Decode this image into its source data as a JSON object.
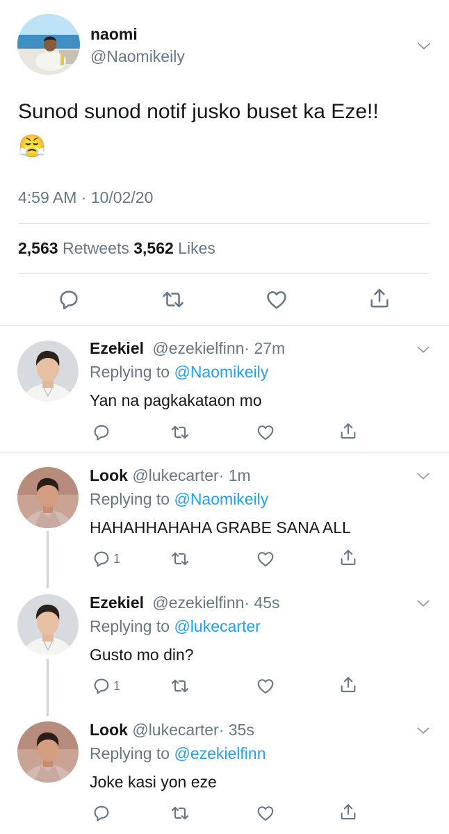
{
  "main_tweet": {
    "display_name": "naomi",
    "handle": "@Naomikeily",
    "text": "Sunod sunod notif jusko buset ka Eze!!",
    "emoji": "😤",
    "timestamp": "4:59 AM · 10/02/20",
    "retweets_count": "2,563",
    "retweets_label": "Retweets",
    "likes_count": "3,562",
    "likes_label": "Likes"
  },
  "replies": [
    {
      "display_name": "Ezekiel",
      "handle": "@ezekielfinn",
      "time": "· 27m",
      "replying_prefix": "Replying to",
      "replying_to": "@Naomikeily",
      "text": "Yan na pagkakataon mo",
      "reply_count": ""
    },
    {
      "display_name": "Look",
      "handle": "@lukecarter",
      "time": "· 1m",
      "replying_prefix": "Replying to",
      "replying_to": "@Naomikeily",
      "text": "HAHAHHAHAHA GRABE SANA ALL",
      "reply_count": "1"
    },
    {
      "display_name": "Ezekiel",
      "handle": "@ezekielfinn",
      "time": "· 45s",
      "replying_prefix": "Replying to",
      "replying_to": "@lukecarter",
      "text": "Gusto mo din?",
      "reply_count": "1"
    },
    {
      "display_name": "Look",
      "handle": "@lukecarter",
      "time": "· 35s",
      "replying_prefix": "Replying to",
      "replying_to": "@ezekielfinn",
      "text": "Joke kasi yon eze",
      "reply_count": ""
    }
  ],
  "icons": {
    "reply": "speech-bubble-icon",
    "retweet": "retweet-arrows-icon",
    "like": "heart-icon",
    "share": "share-upload-icon",
    "more": "chevron-down-icon"
  },
  "colors": {
    "link": "#1da1f2",
    "muted": "#657786",
    "divider": "#e1e8ed"
  }
}
